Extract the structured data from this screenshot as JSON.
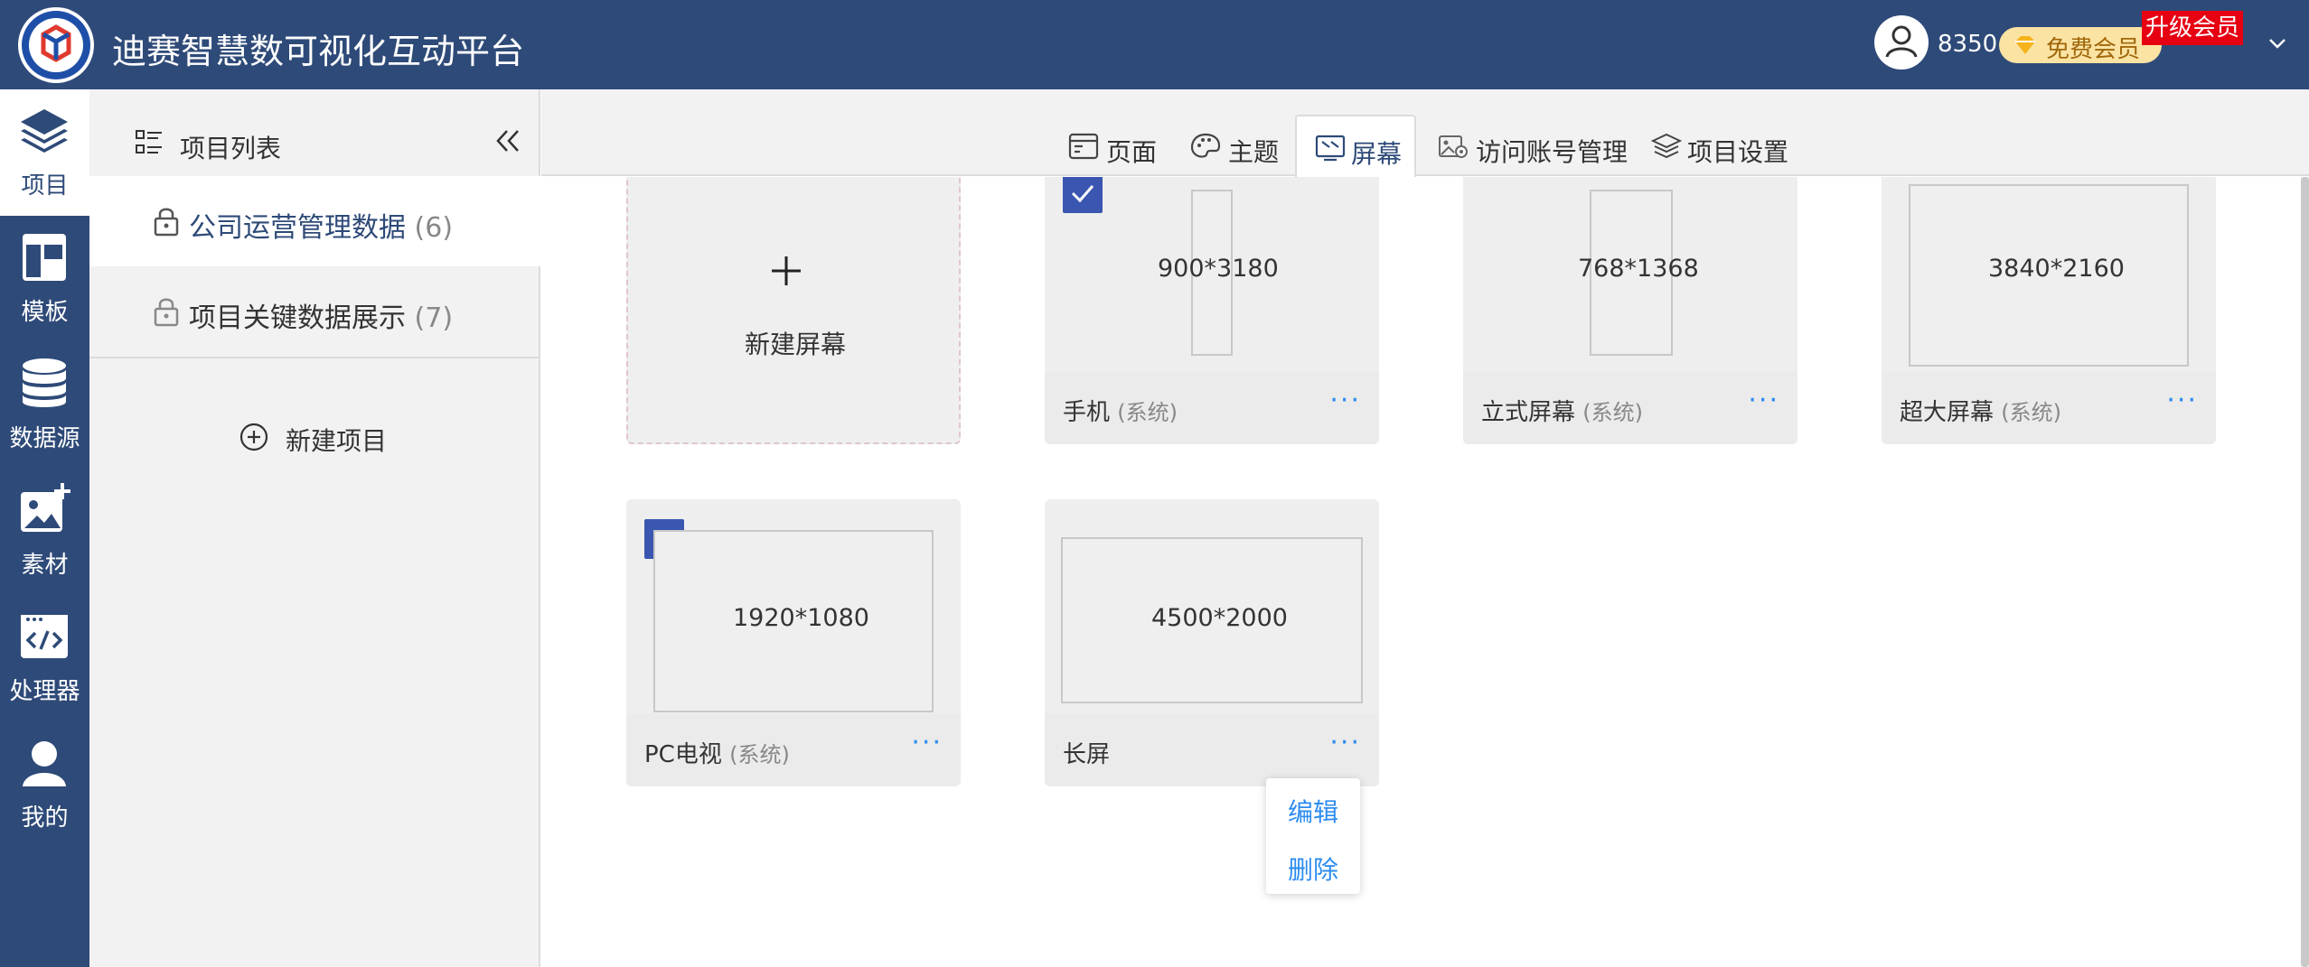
{
  "app": {
    "title": "迪赛智慧数可视化互动平台",
    "points": "8350",
    "vip_label": "免费会员",
    "upgrade_label": "升级会员"
  },
  "nav": {
    "items": [
      {
        "label": "项目",
        "icon": "layers-icon",
        "active": true
      },
      {
        "label": "模板",
        "icon": "template-icon"
      },
      {
        "label": "数据源",
        "icon": "database-icon"
      },
      {
        "label": "素材",
        "icon": "image-add-icon"
      },
      {
        "label": "处理器",
        "icon": "code-icon"
      },
      {
        "label": "我的",
        "icon": "user-icon"
      }
    ]
  },
  "panel": {
    "title": "项目列表",
    "projects": [
      {
        "name": "公司运营管理数据",
        "count": "(6)",
        "selected": true
      },
      {
        "name": "项目关键数据展示",
        "count": "(7)"
      }
    ],
    "new_project_label": "新建项目"
  },
  "tabs": [
    {
      "label": "页面",
      "icon": "page-icon"
    },
    {
      "label": "主题",
      "icon": "palette-icon"
    },
    {
      "label": "屏幕",
      "icon": "screen-icon",
      "active": true
    },
    {
      "label": "访问账号管理",
      "icon": "account-image-icon"
    },
    {
      "label": "项目设置",
      "icon": "settings-layers-icon"
    }
  ],
  "screens": {
    "new_label": "新建屏幕",
    "cards": [
      {
        "name": "手机",
        "tag": "(系统)",
        "dim": "900*3180",
        "checked": true
      },
      {
        "name": "立式屏幕",
        "tag": "(系统)",
        "dim": "768*1368",
        "checked": false
      },
      {
        "name": "超大屏幕",
        "tag": "(系统)",
        "dim": "3840*2160",
        "checked": false
      },
      {
        "name": "PC电视",
        "tag": "(系统)",
        "dim": "1920*1080",
        "checked": true
      },
      {
        "name": "长屏",
        "tag": "",
        "dim": "4500*2000",
        "checked": false
      }
    ],
    "more_label": "···",
    "menu": {
      "edit": "编辑",
      "delete": "删除"
    }
  },
  "colors": {
    "header_bg": "#2e4a78",
    "accent_blue": "#2d8cf0",
    "checkbox": "#3a56b0",
    "upgrade_badge": "#e60012",
    "vip_bg": "#fbe3a4"
  }
}
